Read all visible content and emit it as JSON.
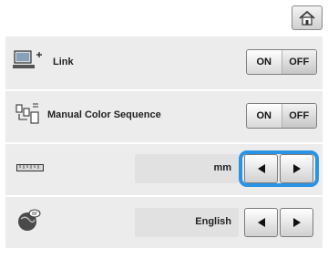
{
  "header": {
    "home_icon": "home-icon"
  },
  "settings": [
    {
      "id": "link",
      "icon": "computer-link-icon",
      "label": "Link",
      "control": "onoff",
      "on_label": "ON",
      "off_label": "OFF"
    },
    {
      "id": "manual-color",
      "icon": "color-sequence-icon",
      "label": "Manual Color Sequence",
      "control": "onoff",
      "on_label": "ON",
      "off_label": "OFF"
    },
    {
      "id": "unit",
      "icon": "ruler-icon",
      "label": "",
      "control": "select",
      "value": "mm"
    },
    {
      "id": "language",
      "icon": "globe-icon",
      "label": "",
      "control": "select",
      "value": "English"
    }
  ],
  "colors": {
    "panel": "#ececec",
    "focus": "#2a93e3"
  }
}
